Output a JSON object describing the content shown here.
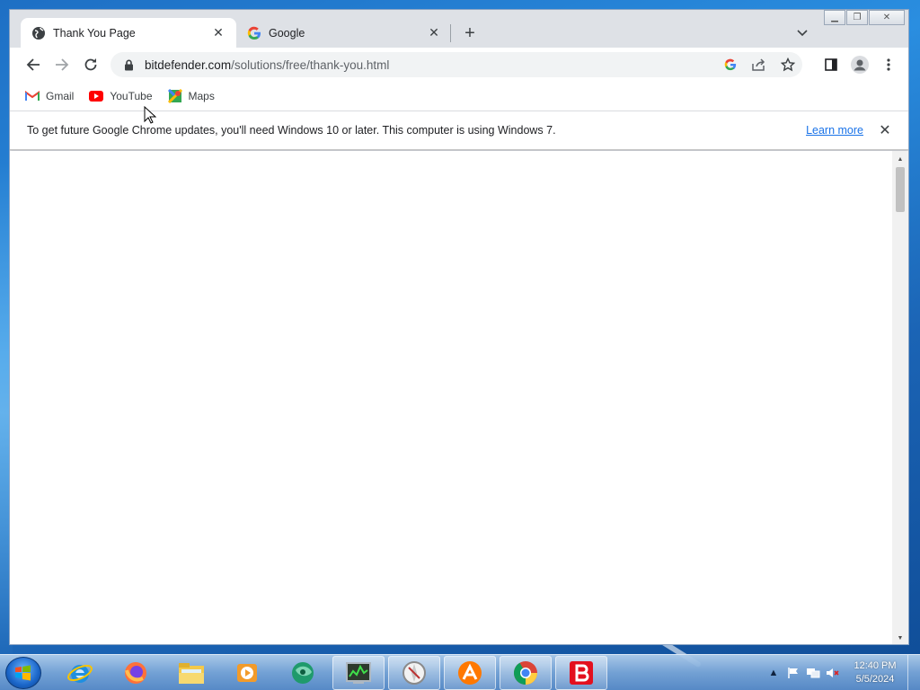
{
  "browser": {
    "tabs": [
      {
        "title": "Thank You Page",
        "active": true,
        "favicon": "globe-icon"
      },
      {
        "title": "Google",
        "active": false,
        "favicon": "google-icon"
      }
    ],
    "address": {
      "host": "bitdefender.com",
      "path": "/solutions/free/thank-you.html"
    },
    "bookmarks": [
      {
        "label": "Gmail",
        "icon": "gmail-icon"
      },
      {
        "label": "YouTube",
        "icon": "youtube-icon"
      },
      {
        "label": "Maps",
        "icon": "maps-icon"
      }
    ],
    "infobar": {
      "message": "To get future Google Chrome updates, you'll need Windows 10 or later. This computer is using Windows 7.",
      "link": "Learn more"
    }
  },
  "taskbar": {
    "apps": [
      "internet-explorer-icon",
      "firefox-icon",
      "file-explorer-icon",
      "media-player-icon",
      "app-globe-icon",
      "task-manager-icon",
      "safari-icon",
      "avast-icon",
      "chrome-icon",
      "bitdefender-icon"
    ],
    "clock": {
      "time": "12:40 PM",
      "date": "5/5/2024"
    }
  },
  "colors": {
    "accent": "#1a73e8",
    "tab_strip": "#dee1e6",
    "bitdefender_red": "#e3101e"
  }
}
